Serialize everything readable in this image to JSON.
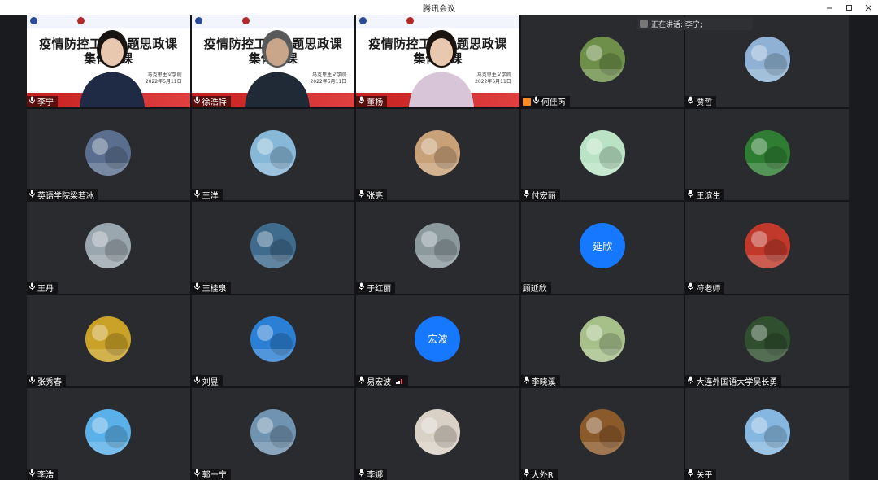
{
  "window": {
    "title": "腾讯会议"
  },
  "speaking_indicator": {
    "label": "正在讲话: 李宁;"
  },
  "slide": {
    "title_line1": "疫情防控工作专题思政课",
    "title_line2": "集体备课",
    "school": "马克思主义学院",
    "date": "2022年5月11日"
  },
  "participants": [
    {
      "name": "李宁",
      "kind": "video",
      "speaking": true,
      "mic": true
    },
    {
      "name": "徐浩特",
      "kind": "video",
      "mic": true
    },
    {
      "name": "董杨",
      "kind": "video",
      "mic": true
    },
    {
      "name": "何佳芮",
      "kind": "avatar",
      "icon": "flower-garden-photo",
      "user_badge": true,
      "mic": true,
      "color": "#6d8f4a"
    },
    {
      "name": "贾哲",
      "kind": "avatar",
      "icon": "tree-blossom-photo",
      "mic": true,
      "color": "#8fb2d4"
    },
    {
      "name": "英语学院梁若冰",
      "kind": "avatar",
      "icon": "street-photo",
      "mic": true,
      "color": "#5a6f8f"
    },
    {
      "name": "王洋",
      "kind": "avatar",
      "icon": "waterfall-photo",
      "mic": true,
      "color": "#87b8d8"
    },
    {
      "name": "张亮",
      "kind": "avatar",
      "icon": "person-photo",
      "mic": true,
      "color": "#c9a178"
    },
    {
      "name": "付宏丽",
      "kind": "avatar",
      "icon": "cup-photo",
      "mic": true,
      "color": "#b9e3c4"
    },
    {
      "name": "王滨生",
      "kind": "avatar",
      "icon": "bamboo-photo",
      "mic": true,
      "color": "#2e7d32"
    },
    {
      "name": "王丹",
      "kind": "avatar",
      "icon": "lake-photo",
      "mic": true,
      "color": "#9aa7ae"
    },
    {
      "name": "王桂泉",
      "kind": "avatar",
      "icon": "ice-photo",
      "mic": true,
      "color": "#3f6b8c"
    },
    {
      "name": "于红丽",
      "kind": "avatar",
      "icon": "waterfall-photo",
      "mic": true,
      "color": "#8c9a9e"
    },
    {
      "name": "顾延欣",
      "kind": "text",
      "avatar_text": "延欣",
      "mic": false,
      "color": "#1677ff"
    },
    {
      "name": "符老师",
      "kind": "avatar",
      "icon": "happy-new-year-photo",
      "mic": true,
      "color": "#c0392b"
    },
    {
      "name": "张秀春",
      "kind": "avatar",
      "icon": "flower-photo",
      "mic": true,
      "color": "#c9a227"
    },
    {
      "name": "刘昱",
      "kind": "avatar",
      "icon": "heart-sky-photo",
      "mic": true,
      "color": "#2b7fd4"
    },
    {
      "name": "易宏波",
      "kind": "text",
      "avatar_text": "宏波",
      "mic": true,
      "signal": true,
      "color": "#1677ff"
    },
    {
      "name": "李晓溪",
      "kind": "avatar",
      "icon": "blossom-photo",
      "mic": true,
      "color": "#a7c08a"
    },
    {
      "name": "大连外国语大学吴长勇",
      "kind": "avatar",
      "icon": "plant-photo",
      "mic": true,
      "color": "#2f4f2f"
    },
    {
      "name": "李浩",
      "kind": "avatar",
      "icon": "cartoon-photo",
      "mic": true,
      "color": "#5ab0e8"
    },
    {
      "name": "郭一宁",
      "kind": "avatar",
      "icon": "sea-photo",
      "mic": true,
      "color": "#6f93b0"
    },
    {
      "name": "李娜",
      "kind": "avatar",
      "icon": "costume-person-photo",
      "mic": true,
      "color": "#d9d1c6"
    },
    {
      "name": "大外R",
      "kind": "avatar",
      "icon": "tea-photo",
      "mic": true,
      "color": "#8b5a2b"
    },
    {
      "name": "关平",
      "kind": "avatar",
      "icon": "blue-flower-photo",
      "mic": true,
      "color": "#86b7e0"
    }
  ]
}
